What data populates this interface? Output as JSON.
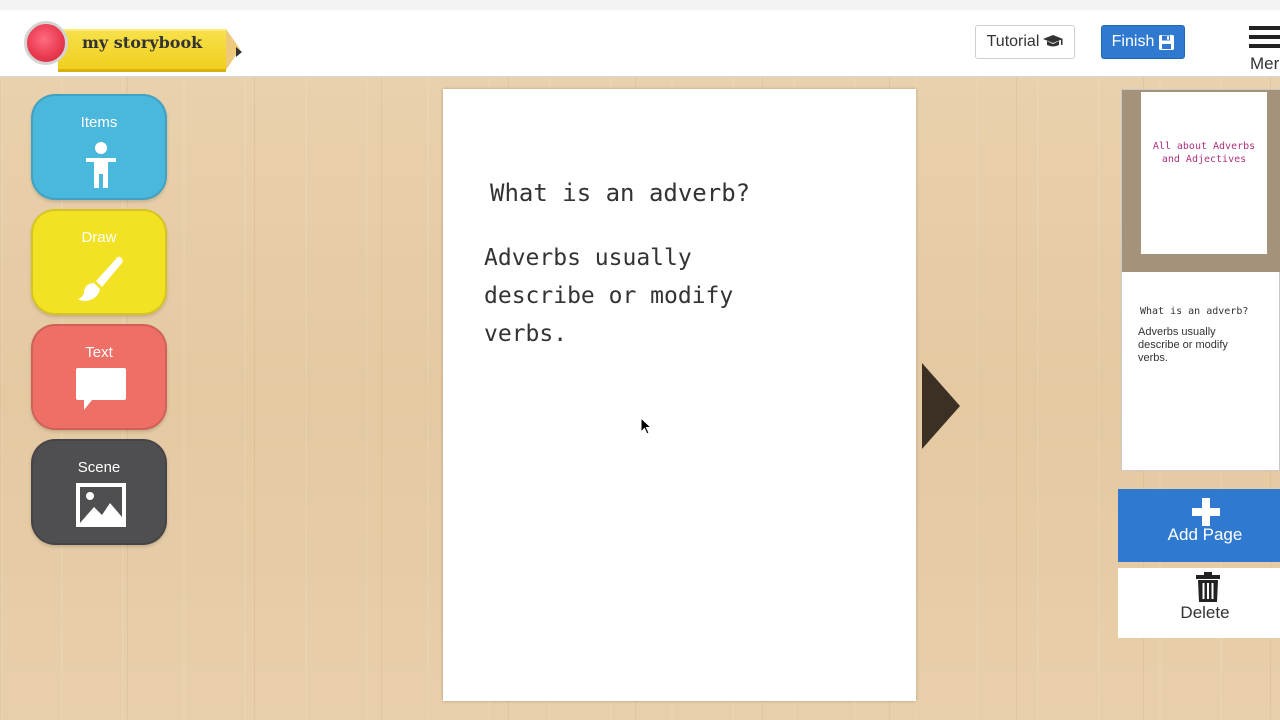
{
  "app": {
    "logo_text": "my storybook"
  },
  "header": {
    "tutorial_label": "Tutorial",
    "tutorial_icon": "graduation-cap-icon",
    "finish_label": "Finish",
    "finish_icon": "save-icon",
    "menu_label": "Mer"
  },
  "tools": [
    {
      "label": "Items",
      "icon": "person-icon"
    },
    {
      "label": "Draw",
      "icon": "brush-icon"
    },
    {
      "label": "Text",
      "icon": "speech-bubble-icon"
    },
    {
      "label": "Scene",
      "icon": "image-icon"
    }
  ],
  "page": {
    "heading": "What is an adverb?",
    "body": "Adverbs usually describe or modify verbs."
  },
  "thumbnails": [
    {
      "title": "All about Adverbs and Adjectives"
    },
    {
      "heading": "What is an adverb?",
      "body": "Adverbs usually describe or modify verbs."
    }
  ],
  "sidebar_actions": {
    "add_label": "Add Page",
    "delete_label": "Delete"
  },
  "colors": {
    "items": "#4ab8dc",
    "draw": "#f3e224",
    "text": "#ee6f65",
    "scene": "#4f4f51",
    "primary": "#2f7ad0",
    "cover_title": "#b0307e"
  }
}
